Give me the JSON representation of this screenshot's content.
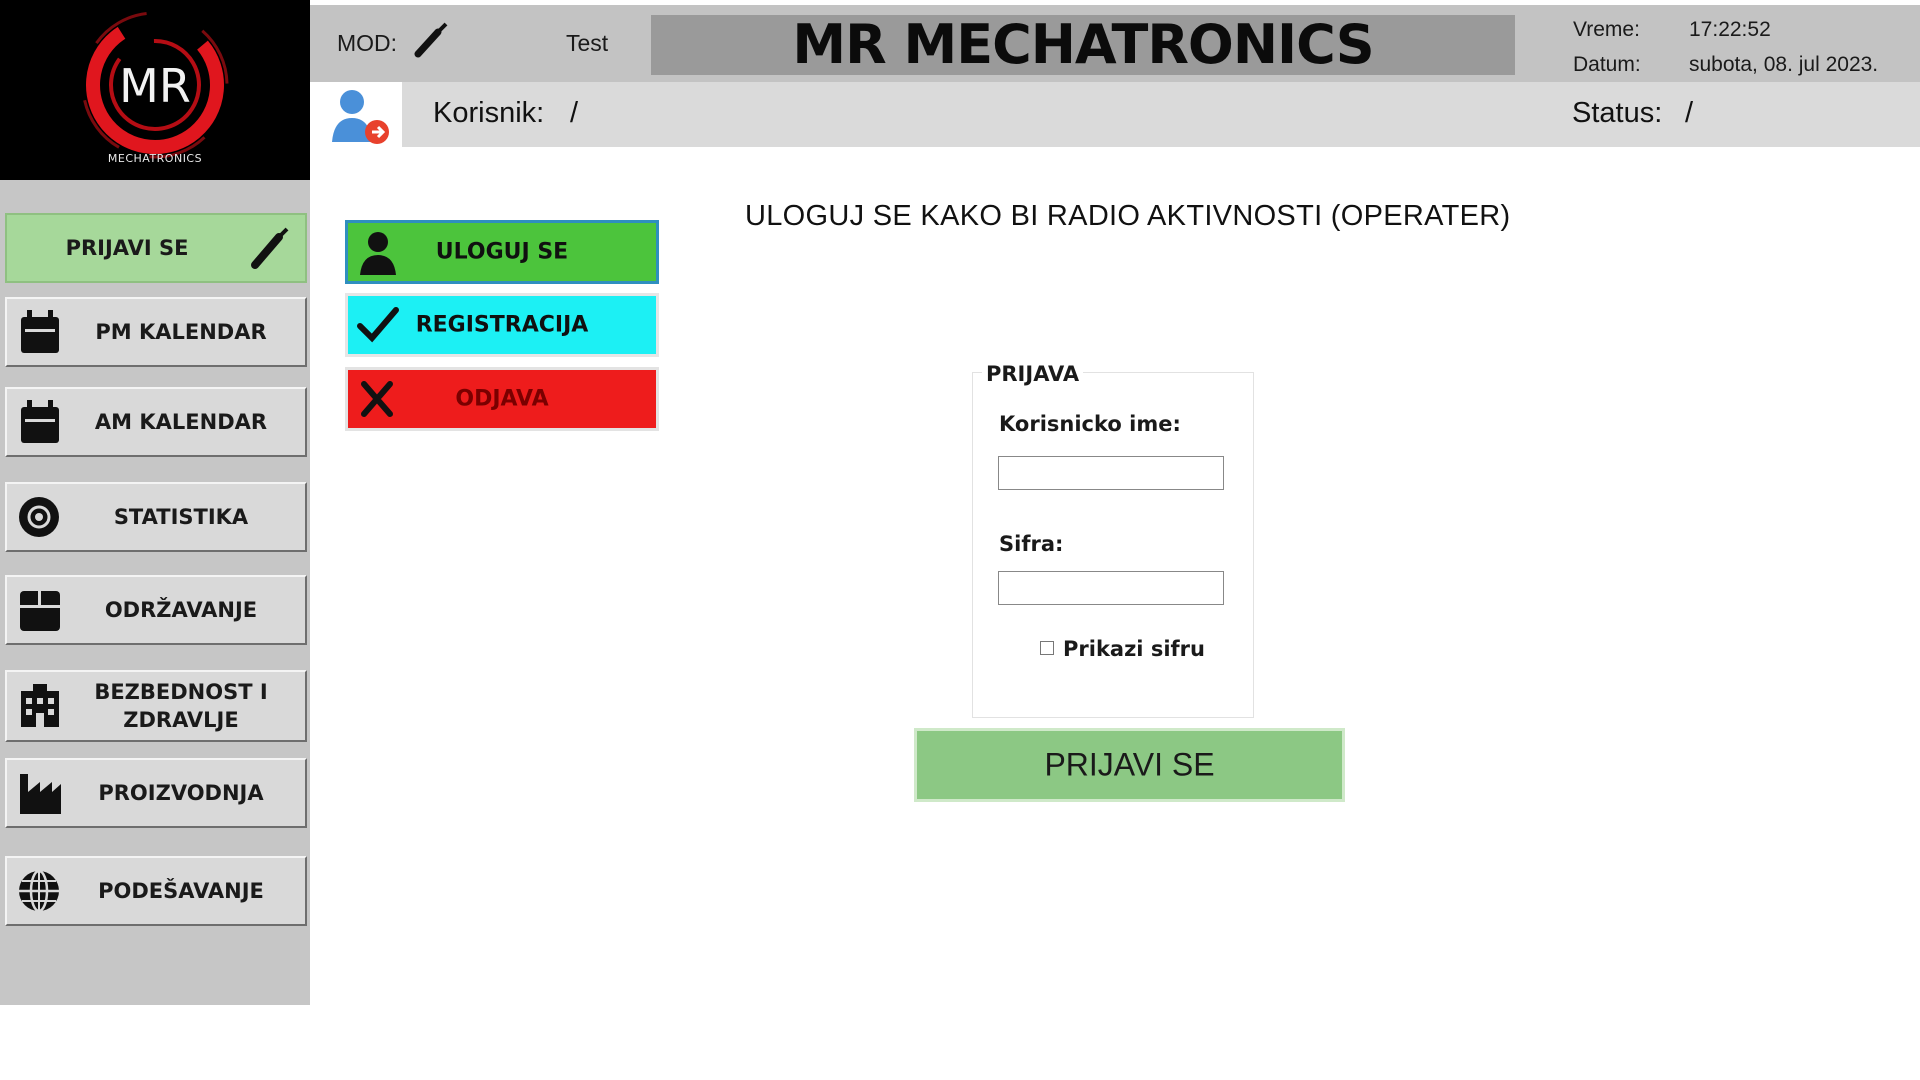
{
  "brand": {
    "logo_monogram": "MR",
    "logo_caption": "MECHATRONICS",
    "title": "MR MECHATRONICS"
  },
  "header": {
    "mod_label": "MOD:",
    "mod_icon": "wrench-icon",
    "mod_value": "Test",
    "time_label": "Vreme:",
    "time_value": "17:22:52",
    "date_label": "Datum:",
    "date_value": "subota, 08. jul 2023.",
    "user_icon": "user-logout-icon",
    "user_label": "Korisnik:",
    "user_value": "/",
    "status_label": "Status:",
    "status_value": "/"
  },
  "sidebar": {
    "items": [
      {
        "label": "PRIJAVI SE",
        "icon": "wrench-icon",
        "active": true
      },
      {
        "label": "PM KALENDAR",
        "icon": "calendar-icon"
      },
      {
        "label": "AM KALENDAR",
        "icon": "calendar-icon"
      },
      {
        "label": "STATISTIKA",
        "icon": "disc-icon"
      },
      {
        "label": "ODRŽAVANJE",
        "icon": "box-icon"
      },
      {
        "label": "BEZBEDNOST I ZDRAVLJE",
        "icon": "building-icon"
      },
      {
        "label": "PROIZVODNJA",
        "icon": "factory-icon"
      },
      {
        "label": "PODEŠAVANJE",
        "icon": "globe-icon"
      }
    ]
  },
  "actions": {
    "login": {
      "label": "ULOGUJ SE",
      "icon": "user-icon"
    },
    "register": {
      "label": "REGISTRACIJA",
      "icon": "checkmark-icon"
    },
    "logout": {
      "label": "ODJAVA",
      "icon": "close-icon"
    }
  },
  "main": {
    "heading": "ULOGUJ SE KAKO BI RADIO AKTIVNOSTI (OPERATER)",
    "login_form": {
      "legend": "PRIJAVA",
      "username_label": "Korisnicko ime:",
      "username_value": "",
      "password_label": "Sifra:",
      "password_value": "",
      "show_password_label": "Prikazi sifru",
      "show_password_checked": false,
      "submit_label": "PRIJAVI SE"
    }
  },
  "colors": {
    "active_nav": "#a6d89a",
    "login_button": "#4cc43c",
    "register_button": "#1cf0f4",
    "logout_button": "#ee1c1c",
    "submit_button": "#8cc884",
    "logo_ring": "#e0161e"
  }
}
